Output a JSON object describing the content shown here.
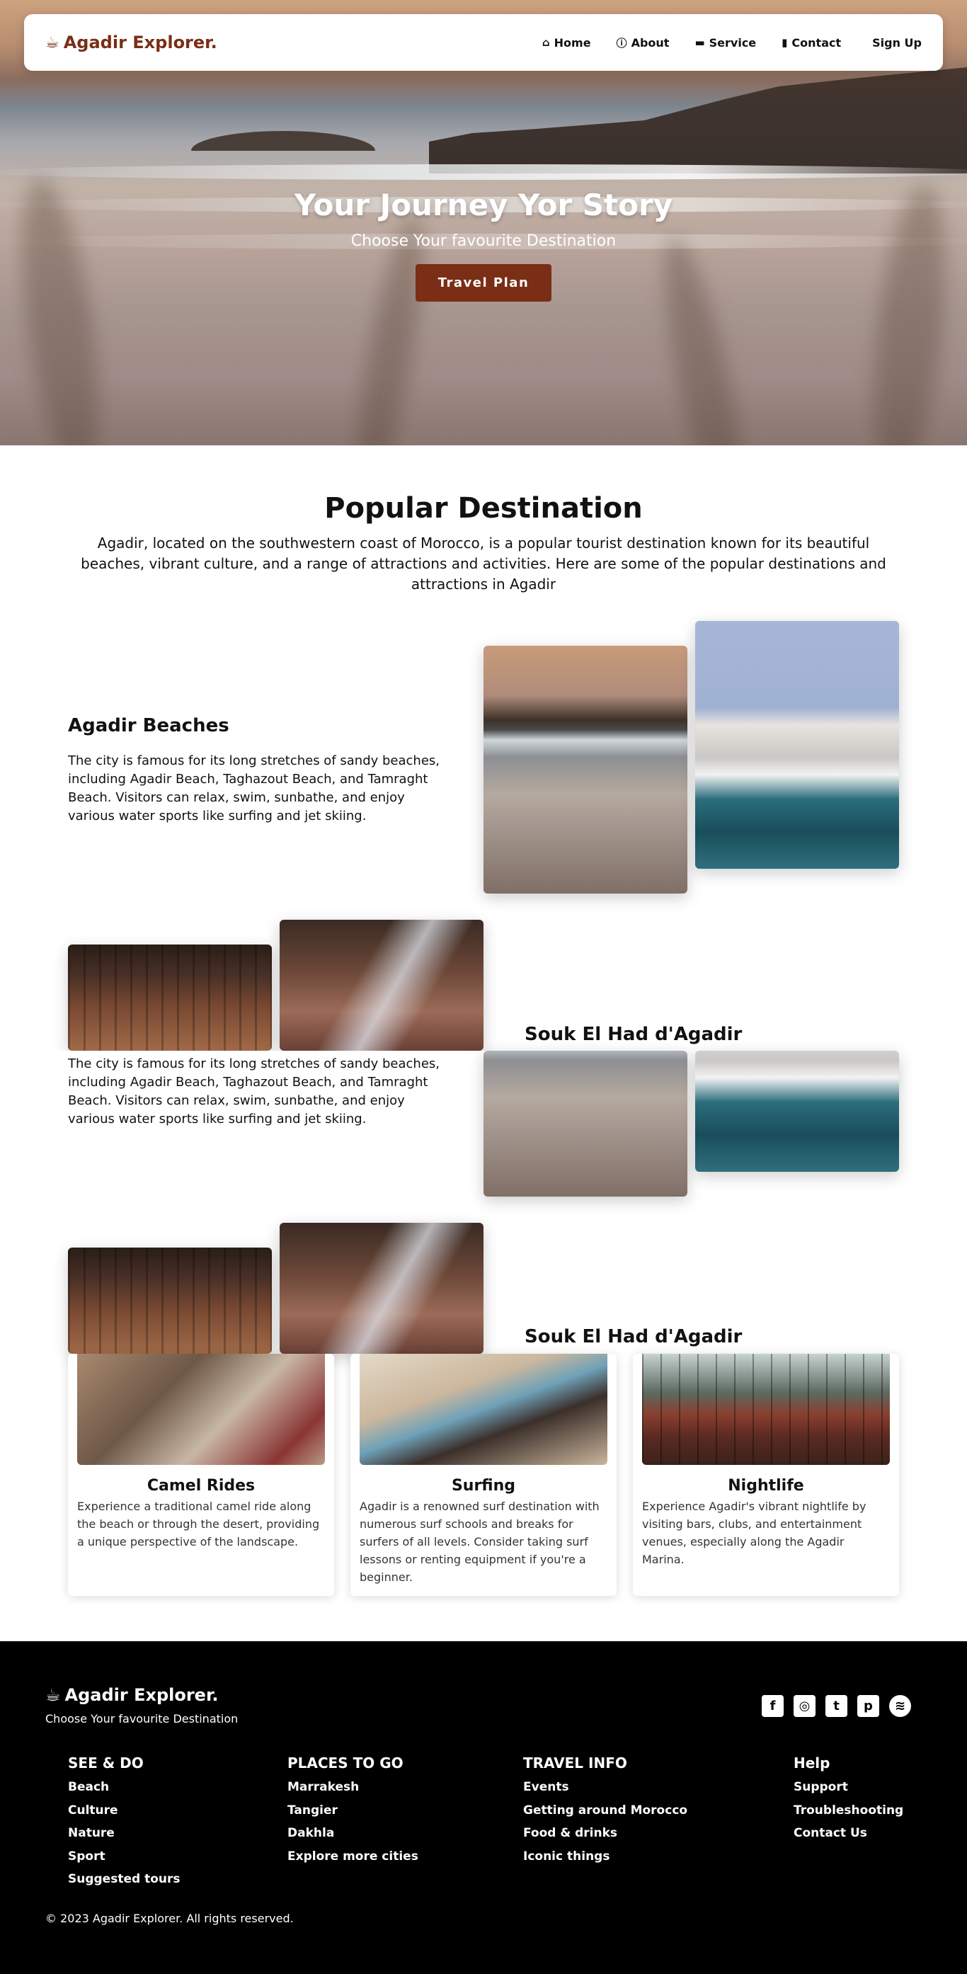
{
  "brand": {
    "name": "Agadir Explorer.",
    "logo_icon": "steam-cup-icon"
  },
  "nav": {
    "links": [
      {
        "label": "Home",
        "icon": "home-icon"
      },
      {
        "label": "About",
        "icon": "info-icon"
      },
      {
        "label": "Service",
        "icon": "briefcase-icon"
      },
      {
        "label": "Contact",
        "icon": "contact-card-icon"
      }
    ],
    "signup": "Sign Up"
  },
  "hero": {
    "title": "Your Journey Yor Story",
    "subtitle": "Choose Your favourite Destination",
    "button": "Travel Plan"
  },
  "popular": {
    "title": "Popular Destination",
    "intro": "Agadir, located on the southwestern coast of Morocco, is a popular tourist destination known for its beautiful beaches, vibrant culture, and a range of attractions and activities. Here are some of the popular destinations and attractions in Agadir"
  },
  "destinations": [
    {
      "title": "Agadir Beaches",
      "text": "The city is famous for its long stretches of sandy beaches, including Agadir Beach, Taghazout Beach, and Tamraght Beach. Visitors can relax, swim, sunbathe, and enjoy various water sports like surfing and jet skiing."
    },
    {
      "title": "Souk El Had d'Agadir",
      "text": "The city is famous for its long stretches of sandy beaches, including Agadir Beach, Taghazout Beach, and Tamraght Beach. Visitors can relax, swim, sunbathe, and enjoy various water sports like surfing and jet skiing."
    },
    {
      "title": "Souk El Had d'Agadir"
    }
  ],
  "activities": [
    {
      "title": "Camel Rides",
      "text": "Experience a traditional camel ride along the beach or through the desert, providing a unique perspective of the landscape."
    },
    {
      "title": "Surfing",
      "text": "Agadir is a renowned surf destination with numerous surf schools and breaks for surfers of all levels. Consider taking surf lessons or renting equipment if you're a beginner."
    },
    {
      "title": "Nightlife",
      "text": "Experience Agadir's vibrant nightlife by visiting bars, clubs, and entertainment venues, especially along the Agadir Marina."
    }
  ],
  "footer": {
    "brand": "Agadir Explorer.",
    "tagline": "Choose Your favourite Destination",
    "socials": [
      "facebook-icon",
      "instagram-icon",
      "twitter-icon",
      "pinterest-icon",
      "spotify-icon"
    ],
    "columns": [
      {
        "heading": "SEE & DO",
        "links": [
          "Beach",
          "Culture",
          "Nature",
          "Sport",
          "Suggested tours"
        ]
      },
      {
        "heading": "PLACES TO GO",
        "links": [
          "Marrakesh",
          "Tangier",
          "Dakhla",
          "Explore more cities"
        ]
      },
      {
        "heading": "TRAVEL INFO",
        "links": [
          "Events",
          "Getting around Morocco",
          "Food & drinks",
          "Iconic things"
        ]
      },
      {
        "heading": "Help",
        "links": [
          "Support",
          "Troubleshooting",
          "Contact Us"
        ]
      }
    ],
    "copyright": "© 2023 Agadir Explorer. All rights reserved."
  }
}
